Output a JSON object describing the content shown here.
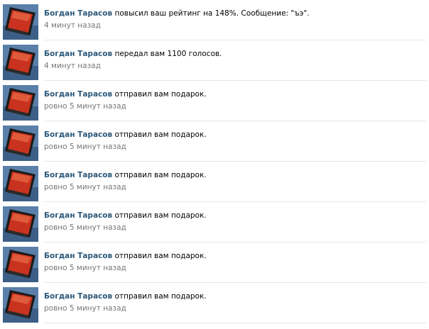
{
  "notifications": [
    {
      "author": "Богдан Тарасов",
      "text": " повысил ваш рейтинг на 148%. Сообщение: \"ъэ\".",
      "time": "4 минут назад"
    },
    {
      "author": "Богдан Тарасов",
      "text": " передал вам 1100 голосов.",
      "time": "4 минут назад"
    },
    {
      "author": "Богдан Тарасов",
      "text": " отправил вам подарок.",
      "time": "ровно 5 минут назад"
    },
    {
      "author": "Богдан Тарасов",
      "text": " отправил вам подарок.",
      "time": "ровно 5 минут назад"
    },
    {
      "author": "Богдан Тарасов",
      "text": " отправил вам подарок.",
      "time": "ровно 5 минут назад"
    },
    {
      "author": "Богдан Тарасов",
      "text": " отправил вам подарок.",
      "time": "ровно 5 минут назад"
    },
    {
      "author": "Богдан Тарасов",
      "text": " отправил вам подарок.",
      "time": "ровно 5 минут назад"
    },
    {
      "author": "Богдан Тарасов",
      "text": " отправил вам подарок.",
      "time": "ровно 5 минут назад"
    }
  ],
  "colors": {
    "author_link": "#2b587a",
    "timestamp": "#777777",
    "divider": "#e4e8ed"
  }
}
